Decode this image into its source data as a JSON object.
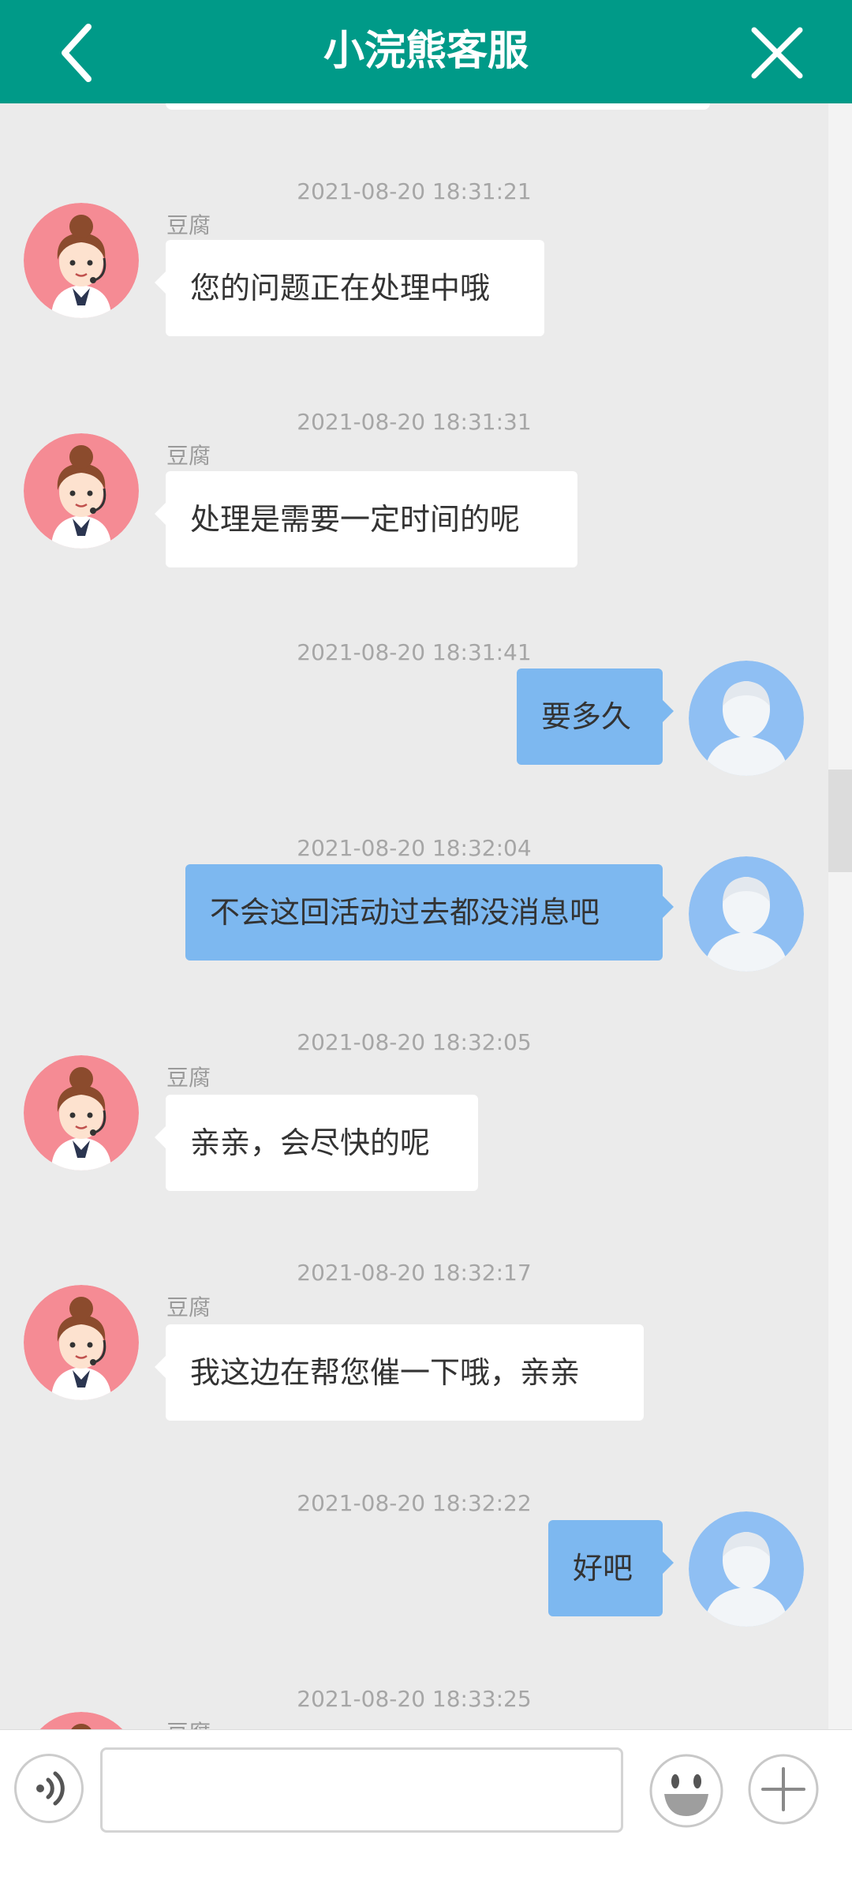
{
  "header": {
    "title": "小浣熊客服",
    "back_icon": "back-arrow-icon",
    "close_icon": "close-icon"
  },
  "messages": [
    {
      "time": "2021-08-20 18:31:21",
      "side": "left",
      "name": "豆腐",
      "text": "您的问题正在处理中哦"
    },
    {
      "time": "2021-08-20 18:31:31",
      "side": "left",
      "name": "豆腐",
      "text": "处理是需要一定时间的呢"
    },
    {
      "time": "2021-08-20 18:31:41",
      "side": "right",
      "text": "要多久"
    },
    {
      "time": "2021-08-20 18:32:04",
      "side": "right",
      "text": "不会这回活动过去都没消息吧"
    },
    {
      "time": "2021-08-20 18:32:05",
      "side": "left",
      "name": "豆腐",
      "text": "亲亲，会尽快的呢"
    },
    {
      "time": "2021-08-20 18:32:17",
      "side": "left",
      "name": "豆腐",
      "text": "我这边在帮您催一下哦，亲亲"
    },
    {
      "time": "2021-08-20 18:32:22",
      "side": "right",
      "text": "好吧"
    },
    {
      "time": "2021-08-20 18:33:25",
      "side": "left",
      "name": "豆腐",
      "text": ""
    }
  ],
  "input": {
    "value": "",
    "placeholder": ""
  },
  "colors": {
    "header": "#009a88",
    "user_bubble": "#7db8f0",
    "agent_bubble": "#ffffff",
    "background": "#ebebeb"
  },
  "icons": {
    "voice": "voice-icon",
    "emoji": "emoji-icon",
    "more": "plus-icon"
  }
}
